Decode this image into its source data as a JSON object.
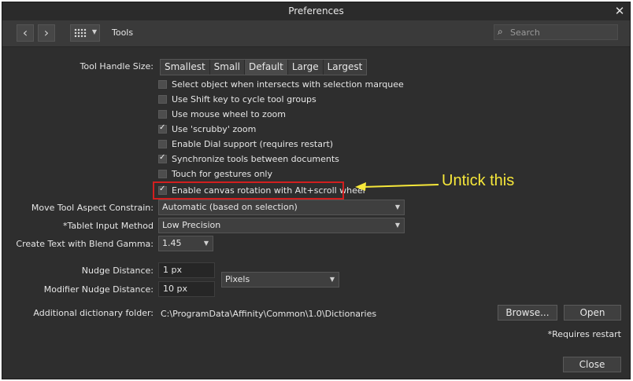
{
  "window": {
    "title": "Preferences",
    "close_glyph": "✕"
  },
  "toolbar": {
    "back_icon": "chevron-left-icon",
    "forward_icon": "chevron-right-icon",
    "grid_icon": "grid-icon",
    "breadcrumb": "Tools",
    "search_placeholder": "Search"
  },
  "tool_handle": {
    "label": "Tool Handle Size:",
    "options": [
      "Smallest",
      "Small",
      "Default",
      "Large",
      "Largest"
    ],
    "selected": "Default"
  },
  "checkboxes": [
    {
      "label": "Select object when intersects with selection marquee",
      "checked": false
    },
    {
      "label": "Use Shift key to cycle tool groups",
      "checked": false
    },
    {
      "label": "Use mouse wheel to zoom",
      "checked": false
    },
    {
      "label": "Use 'scrubby' zoom",
      "checked": true
    },
    {
      "label": "Enable Dial support (requires restart)",
      "checked": false
    },
    {
      "label": "Synchronize tools between documents",
      "checked": true
    },
    {
      "label": "Touch for gestures only",
      "checked": false
    },
    {
      "label": "Enable canvas rotation with Alt+scroll wheel",
      "checked": true
    }
  ],
  "annotation": {
    "text": "Untick this",
    "color": "#f7e83a",
    "box_color": "#d21f1f"
  },
  "move_tool": {
    "label": "Move Tool Aspect Constrain:",
    "value": "Automatic (based on selection)"
  },
  "tablet": {
    "label": "*Tablet Input Method",
    "value": "Low Precision"
  },
  "blend_gamma": {
    "label": "Create Text with Blend Gamma:",
    "value": "1.45"
  },
  "nudge": {
    "label": "Nudge Distance:",
    "value": "1 px"
  },
  "modifier_nudge": {
    "label": "Modifier Nudge Distance:",
    "value": "10 px"
  },
  "units": {
    "value": "Pixels"
  },
  "dictionary": {
    "label": "Additional dictionary folder:",
    "path": "C:\\ProgramData\\Affinity\\Common\\1.0\\Dictionaries",
    "browse_label": "Browse...",
    "open_label": "Open"
  },
  "note": "*Requires restart",
  "close_label": "Close"
}
